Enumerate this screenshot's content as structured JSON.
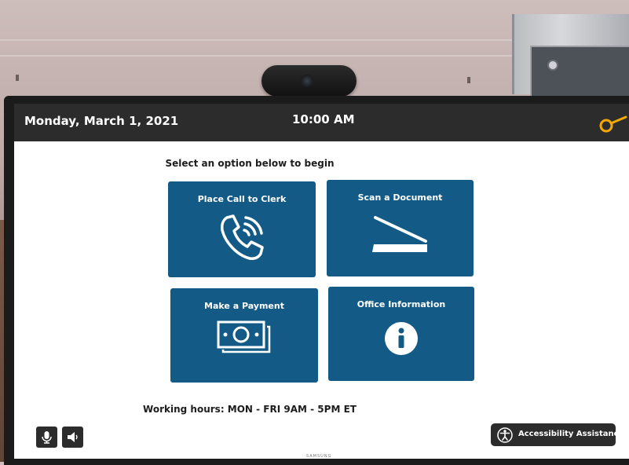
{
  "header": {
    "date": "Monday, March 1, 2021",
    "time": "10:00 AM",
    "icon": "key-icon",
    "accent": "#f5a800"
  },
  "main": {
    "instruction": "Select an option below to begin",
    "tiles": [
      {
        "label": "Place Call to Clerk",
        "icon": "phone-icon"
      },
      {
        "label": "Scan a Document",
        "icon": "scanner-icon"
      },
      {
        "label": "Make a Payment",
        "icon": "cash-icon"
      },
      {
        "label": "Office Information",
        "icon": "info-icon"
      }
    ],
    "hours": "Working hours: MON - FRI  9AM - 5PM ET"
  },
  "footer": {
    "mic_icon": "microphone-icon",
    "speaker_icon": "speaker-icon",
    "accessibility_label": "Accessibility Assistance",
    "accessibility_icon": "accessibility-icon"
  },
  "device": {
    "brand": "SAMSUNG"
  },
  "colors": {
    "tile": "#135b86",
    "topbar": "#2c2c2c"
  }
}
